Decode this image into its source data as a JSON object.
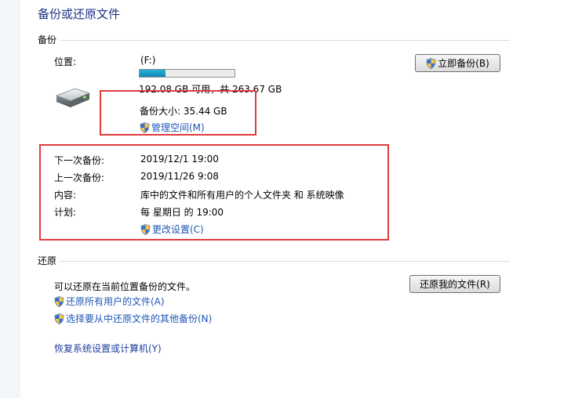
{
  "page": {
    "title": "备份或还原文件"
  },
  "backup": {
    "section_label": "备份",
    "location_label": "位置:",
    "drive": "(F:)",
    "usage_fraction": 0.27,
    "space_text": "192.08 GB 可用，共 263.67 GB",
    "size_text": "备份大小: 35.44 GB",
    "manage_space_link": "管理空间(M)",
    "backup_now_button": "立即备份(B)",
    "next_backup_label": "下一次备份:",
    "next_backup_value": "2019/12/1 19:00",
    "last_backup_label": "上一次备份:",
    "last_backup_value": "2019/11/26 9:08",
    "contents_label": "内容:",
    "contents_value": "库中的文件和所有用户的个人文件夹 和 系统映像",
    "schedule_label": "计划:",
    "schedule_value": "每 星期日 的 19:00",
    "change_settings_link": "更改设置(C)"
  },
  "restore": {
    "section_label": "还原",
    "description": "可以还原在当前位置备份的文件。",
    "restore_my_files_button": "还原我的文件(R)",
    "restore_all_users_link": "还原所有用户的文件(A)",
    "select_other_backup_link": "选择要从中还原文件的其他备份(N)",
    "recover_settings_link": "恢复系统设置或计算机(Y)"
  },
  "colors": {
    "title_blue": "#1e3287",
    "link_blue": "#1f56b6",
    "highlight_red": "#e03a3e",
    "progress_fill": "#1d9cc6"
  },
  "icons": {
    "drive": "hard-drive-icon",
    "shield": "uac-shield-icon"
  }
}
